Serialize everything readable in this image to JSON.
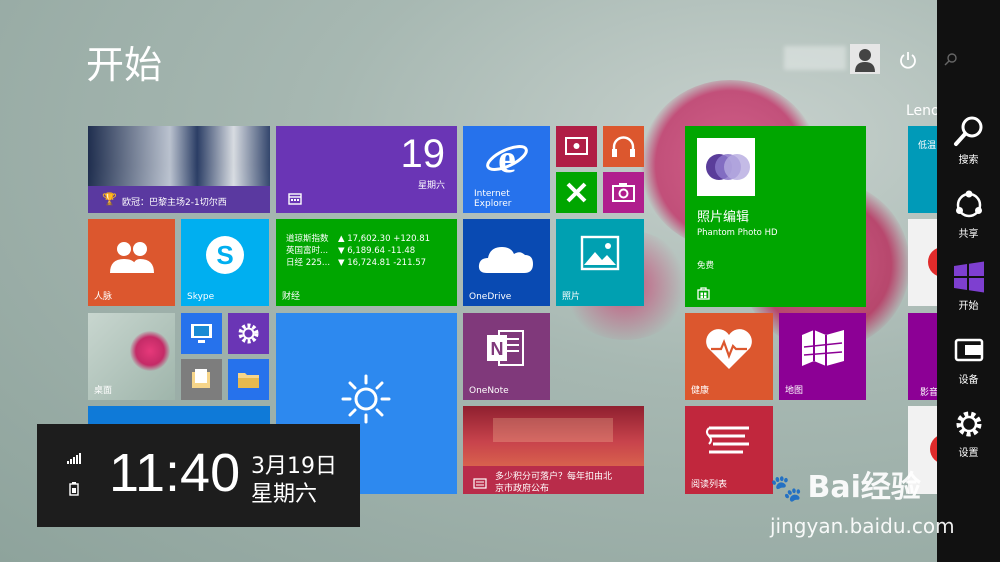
{
  "start": {
    "title": "开始",
    "user_name": ""
  },
  "lenovo_label": "Lenovo 应用",
  "tiles": {
    "news": {
      "caption": "欧冠：巴黎主场2-1切尔西"
    },
    "calendar": {
      "day": "19",
      "weekday": "星期六"
    },
    "ie": {
      "line1": "Internet",
      "line2": "Explorer"
    },
    "people": {
      "label": "人脉"
    },
    "skype": {
      "label": "Skype"
    },
    "finance": {
      "label": "财经",
      "rows": [
        {
          "name": "道琼斯指数",
          "value": "▲ 17,602.30 +120.81"
        },
        {
          "name": "英国富时...",
          "value": "▼ 6,189.64 -11.48"
        },
        {
          "name": "日经 225...",
          "value": "▼ 16,724.81 -211.57"
        }
      ]
    },
    "onedrive": {
      "label": "OneDrive"
    },
    "photos": {
      "label": "照片"
    },
    "photo_editor": {
      "title": "照片编辑",
      "subtitle": "Phantom Photo HD",
      "price": "免费"
    },
    "desktop": {
      "label": "桌面"
    },
    "onenote": {
      "label": "OneNote"
    },
    "health": {
      "label": "健康"
    },
    "maps": {
      "label": "地图"
    },
    "store_news": {
      "line1": "多少积分可落户？每年扣由北",
      "line2": "京市政府公布"
    },
    "reading_list": {
      "label": "阅读列表"
    }
  },
  "right_partial": {
    "label1": "低温",
    "label2": "影音"
  },
  "clock": {
    "time": "11:40",
    "date": "3月19日",
    "weekday": "星期六"
  },
  "charms": [
    {
      "label": "搜索",
      "icon": "search-icon"
    },
    {
      "label": "共享",
      "icon": "share-icon"
    },
    {
      "label": "开始",
      "icon": "windows-logo-icon"
    },
    {
      "label": "设备",
      "icon": "devices-icon"
    },
    {
      "label": "设置",
      "icon": "settings-icon"
    }
  ],
  "watermark": {
    "brand": "Bai经验",
    "url": "jingyan.baidu.com"
  },
  "colors": {
    "purple": "#6a35b5",
    "blue": "#2672ec",
    "green": "#00a600",
    "orange": "#dc572e",
    "cyan": "#00a0d1",
    "magenta": "#8c0095",
    "charm_bar": "#111111"
  }
}
